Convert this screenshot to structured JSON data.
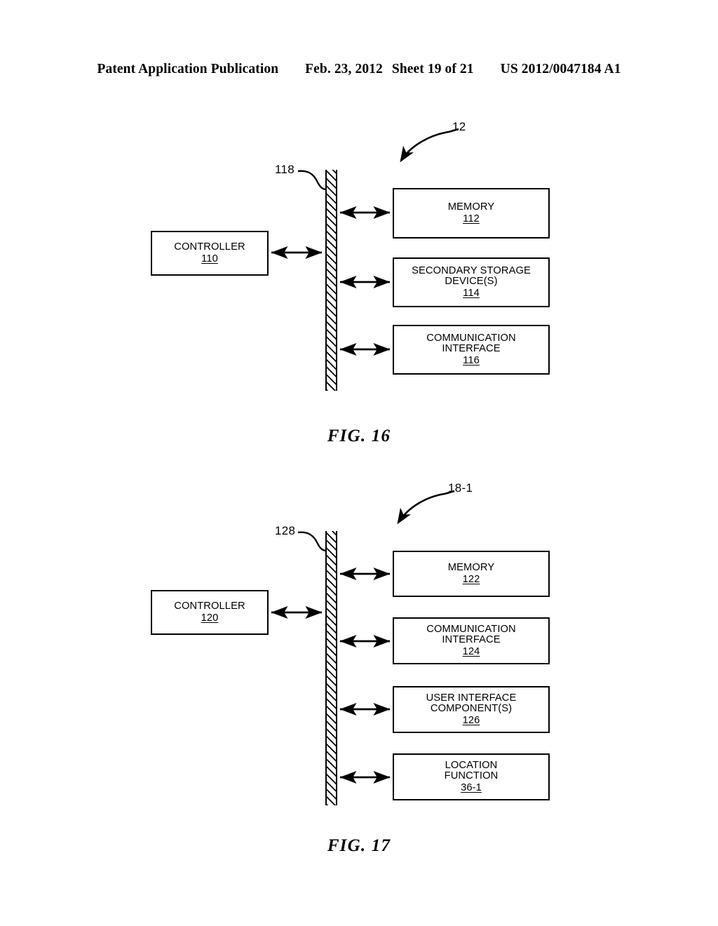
{
  "header": {
    "publication": "Patent Application Publication",
    "date": "Feb. 23, 2012",
    "sheet": "Sheet 19 of 21",
    "docnum": "US 2012/0047184 A1"
  },
  "figures": [
    {
      "id": "fig16",
      "caption": "FIG. 16",
      "system_ref": "12",
      "bus_ref": "118",
      "controller": {
        "label": "CONTROLLER",
        "number": "110"
      },
      "peripherals": [
        {
          "label": "MEMORY",
          "number": "112"
        },
        {
          "label": "SECONDARY STORAGE\nDEVICE(S)",
          "number": "114"
        },
        {
          "label": "COMMUNICATION\nINTERFACE",
          "number": "116"
        }
      ]
    },
    {
      "id": "fig17",
      "caption": "FIG. 17",
      "system_ref": "18-1",
      "bus_ref": "128",
      "controller": {
        "label": "CONTROLLER",
        "number": "120"
      },
      "peripherals": [
        {
          "label": "MEMORY",
          "number": "122"
        },
        {
          "label": "COMMUNICATION\nINTERFACE",
          "number": "124"
        },
        {
          "label": "USER INTERFACE\nCOMPONENT(S)",
          "number": "126"
        },
        {
          "label": "LOCATION\nFUNCTION",
          "number": "36-1"
        }
      ]
    }
  ],
  "colors": {
    "ink": "#000000",
    "paper": "#ffffff"
  }
}
